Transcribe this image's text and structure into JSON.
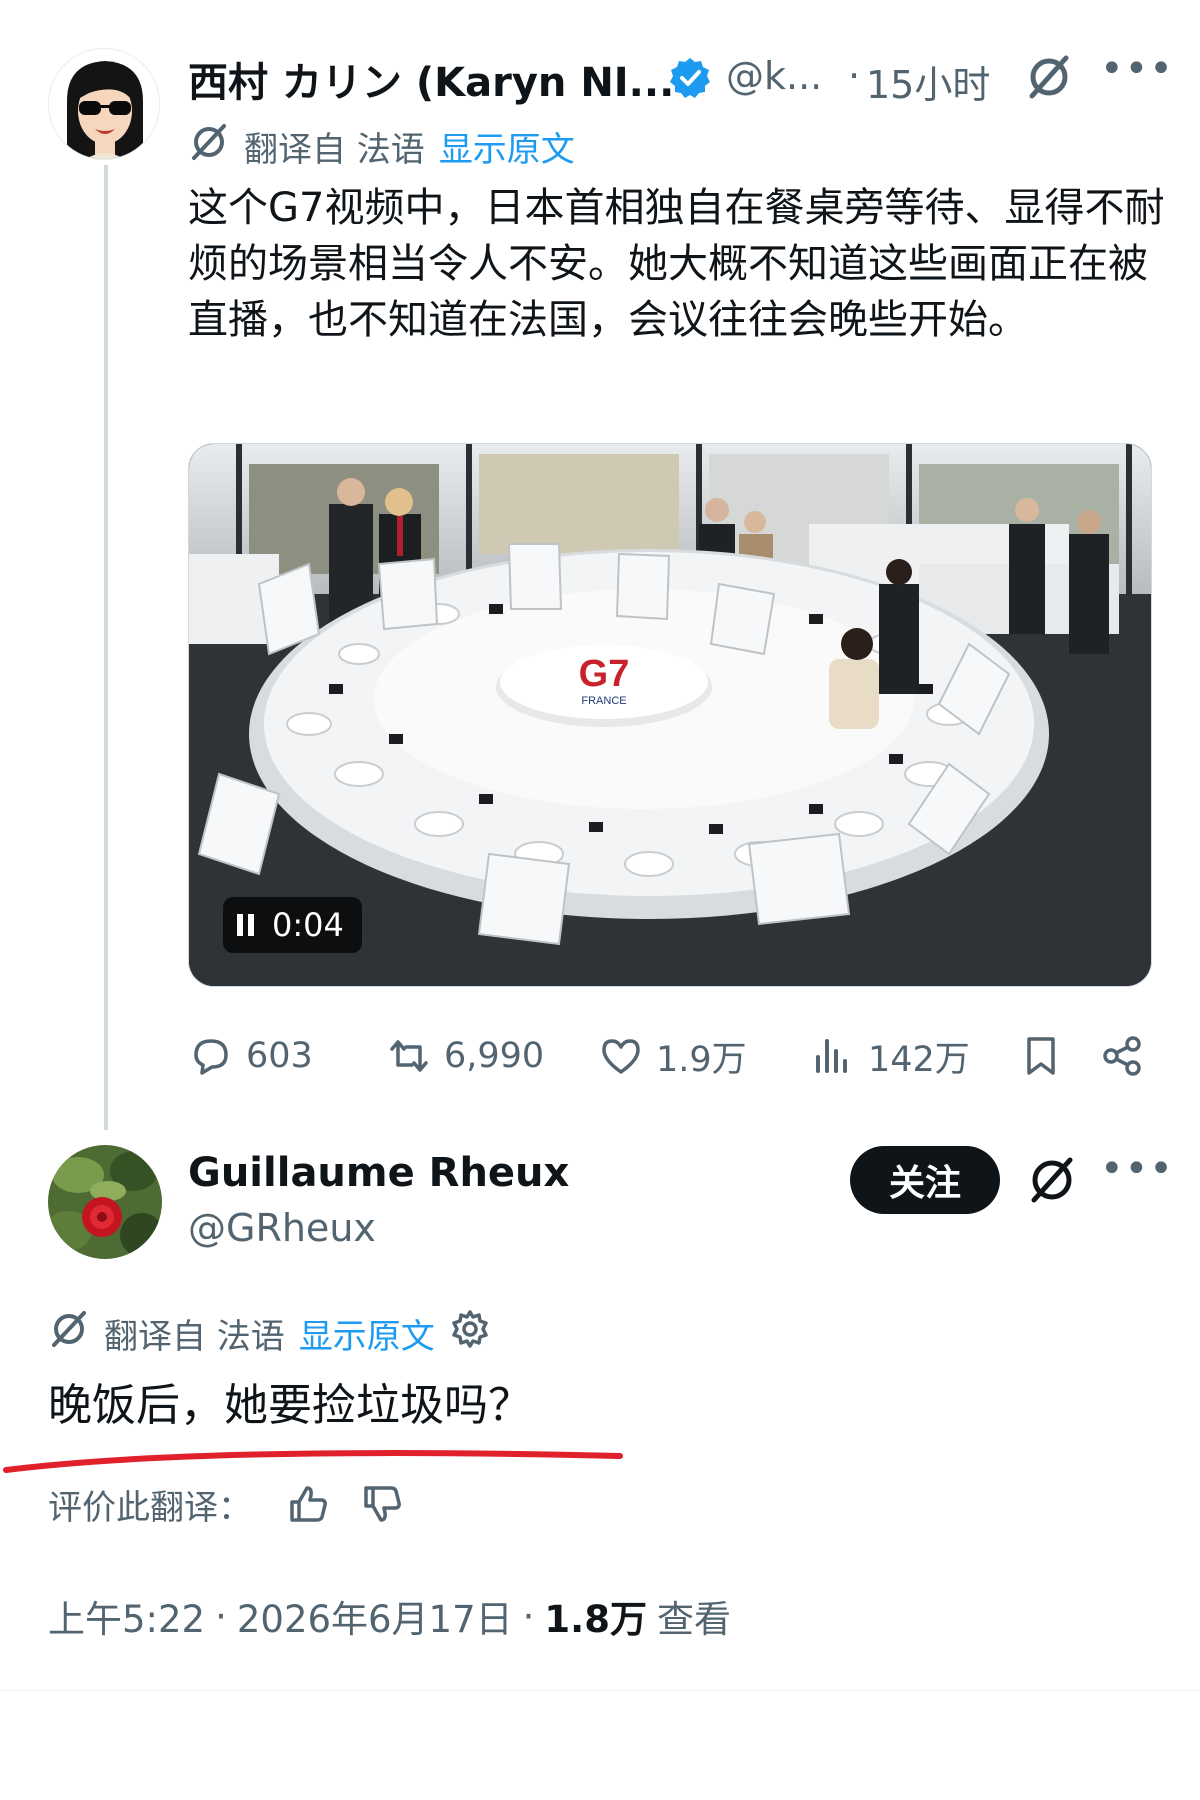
{
  "tweet": {
    "author_name": "西村 カリン (Karyn NI...",
    "handle": "@k...",
    "dot": "·",
    "time": "15小时",
    "translation": {
      "label": "翻译自 法语",
      "show_original": "显示原文"
    },
    "text": "这个G7视频中，日本首相独自在餐桌旁等待、显得不耐烦的场景相当令人不安。她大概不知道这些画面正在被直播，也不知道在法国，会议往往会晚些开始。",
    "video": {
      "timestamp": "0:04",
      "sign_text": "G7",
      "sign_subtext": "FRANCE"
    },
    "stats": {
      "replies": "603",
      "retweets": "6,990",
      "likes": "1.9万",
      "views": "142万"
    }
  },
  "reply": {
    "author_name": "Guillaume Rheux",
    "handle": "@GRheux",
    "follow_label": "关注",
    "translation": {
      "label": "翻译自 法语",
      "show_original": "显示原文"
    },
    "text": "晚饭后，她要捡垃圾吗？",
    "rate_label": "评价此翻译：",
    "meta": {
      "time": "上午5:22",
      "sep1": "·",
      "date": "2026年6月17日",
      "sep2": "·",
      "views_count": "1.8万",
      "views_label": "查看"
    }
  },
  "colors": {
    "text": "#0f1419",
    "secondary": "#536471",
    "link": "#1d9bf0",
    "verified": "#1d9bf0",
    "highlight_underline": "#e0202a"
  },
  "icons": [
    "verified-badge-icon",
    "grok-icon",
    "more-icon",
    "translate-icon",
    "pause-icon",
    "reply-icon",
    "retweet-icon",
    "like-icon",
    "views-icon",
    "bookmark-icon",
    "share-icon",
    "gear-icon",
    "thumbs-up-icon",
    "thumbs-down-icon"
  ]
}
